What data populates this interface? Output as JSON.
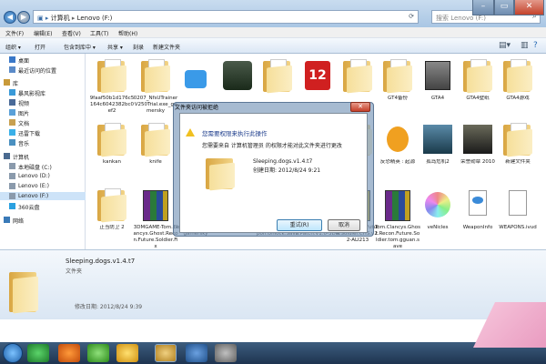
{
  "address": {
    "parts": [
      "计算机",
      "Lenovo (F:)"
    ]
  },
  "search": {
    "placeholder": "搜索 Lenovo (F:)"
  },
  "menubar": [
    "文件(F)",
    "编辑(E)",
    "查看(V)",
    "工具(T)",
    "帮助(H)"
  ],
  "toolbar": [
    "组织 ▾",
    "打开",
    "包含到库中 ▾",
    "共享 ▾",
    "刻录",
    "新建文件夹"
  ],
  "sidebar": {
    "items": [
      {
        "label": "桌面",
        "icon": "desktop-icon",
        "indent": 1
      },
      {
        "label": "最近访问的位置",
        "icon": "recent-icon",
        "indent": 1
      },
      {
        "label": "库",
        "icon": "library-icon",
        "indent": 0
      },
      {
        "label": "暴风影视库",
        "icon": "video-library-icon",
        "indent": 1
      },
      {
        "label": "视频",
        "icon": "video-icon",
        "indent": 1
      },
      {
        "label": "图片",
        "icon": "picture-icon",
        "indent": 1
      },
      {
        "label": "文档",
        "icon": "document-icon",
        "indent": 1
      },
      {
        "label": "迅雷下载",
        "icon": "download-icon",
        "indent": 1
      },
      {
        "label": "音乐",
        "icon": "music-icon",
        "indent": 1
      },
      {
        "label": "计算机",
        "icon": "computer-icon",
        "indent": 0
      },
      {
        "label": "本地磁盘 (C:)",
        "icon": "drive-icon",
        "indent": 1
      },
      {
        "label": "Lenovo (D:)",
        "icon": "drive-icon",
        "indent": 1
      },
      {
        "label": "Lenovo (E:)",
        "icon": "drive-icon",
        "indent": 1
      },
      {
        "label": "Lenovo (F:)",
        "icon": "drive-icon",
        "indent": 1
      },
      {
        "label": "360云盘",
        "icon": "cloud-icon",
        "indent": 1
      },
      {
        "label": "网络",
        "icon": "network-icon",
        "indent": 0
      }
    ]
  },
  "files": [
    {
      "label": "9faaf50b1d176c5164c6042382bc0ef2",
      "type": "folder"
    },
    {
      "label": "0207_NfsUTrainerV250Trial.exe_gamersky",
      "type": "folder"
    },
    {
      "label": "",
      "type": "app"
    },
    {
      "label": "",
      "type": "game"
    },
    {
      "label": "",
      "type": "folder"
    },
    {
      "label": "",
      "type": "game12"
    },
    {
      "label": "",
      "type": "folder"
    },
    {
      "label": "GT4备份",
      "type": "folder"
    },
    {
      "label": "GTA4",
      "type": "gta"
    },
    {
      "label": "GTA4壁纸",
      "type": "folder"
    },
    {
      "label": "GTA4游戏",
      "type": "folder"
    },
    {
      "label": "kankan",
      "type": "folder"
    },
    {
      "label": "knife",
      "type": "folder"
    },
    {
      "label": "",
      "type": "folder"
    },
    {
      "label": "",
      "type": "folder"
    },
    {
      "label": "",
      "type": "folder"
    },
    {
      "label": "",
      "type": "folder"
    },
    {
      "label": "",
      "type": "folder"
    },
    {
      "label": "反恐精英 : 起源",
      "type": "cs"
    },
    {
      "label": "孤岛危机2",
      "type": "crysis"
    },
    {
      "label": "荣誉勋章 2010",
      "type": "moh"
    },
    {
      "label": "新建文件夹",
      "type": "folder"
    },
    {
      "label": "正当防卫 2",
      "type": "folder"
    },
    {
      "label": "3DMGAME-Tom.Clancys.Ghost.Recon.Future.Soldier.Fix",
      "type": "winrar"
    },
    {
      "label": "nerV250Trial.exe_gamersky",
      "type": "winrar"
    },
    {
      "label": "gamersky",
      "type": "winrar"
    },
    {
      "label": "uture.Soldier.Weapon.Unlock.Save",
      "type": "winrar"
    },
    {
      "label": "uture_Soldier_CHS.Patch.V1.0-3DM",
      "type": "winrar"
    },
    {
      "label": "host.Recon.Future.Soldier.CHS.v2.2-ALI213",
      "type": "winrar"
    },
    {
      "label": "Tom.Clancys.Ghost.Recon.Future.Soldier.tom.gguan.save",
      "type": "winrar"
    },
    {
      "label": "veNicles",
      "type": "disc"
    },
    {
      "label": "WeaponInfo",
      "type": "file"
    },
    {
      "label": "WEAPONS.ivud",
      "type": "blank"
    }
  ],
  "dialog": {
    "title": "文件夹访问被拒绝",
    "message1": "您需要权限来执行此操作",
    "message2": "您需要来自 计算机管理员 的权限才能对此文件夹进行更改",
    "folder_name": "Sleeping.dogs.v1.4.t7",
    "created": "创建日期: 2012/8/24 9:21",
    "retry": "重试(R)",
    "cancel": "取消"
  },
  "details": {
    "name": "Sleeping.dogs.v1.4.t7",
    "type": "文件夹",
    "modified": "修改日期: 2012/8/24 9:39"
  },
  "window_controls": [
    "–",
    "▭",
    "✕"
  ]
}
